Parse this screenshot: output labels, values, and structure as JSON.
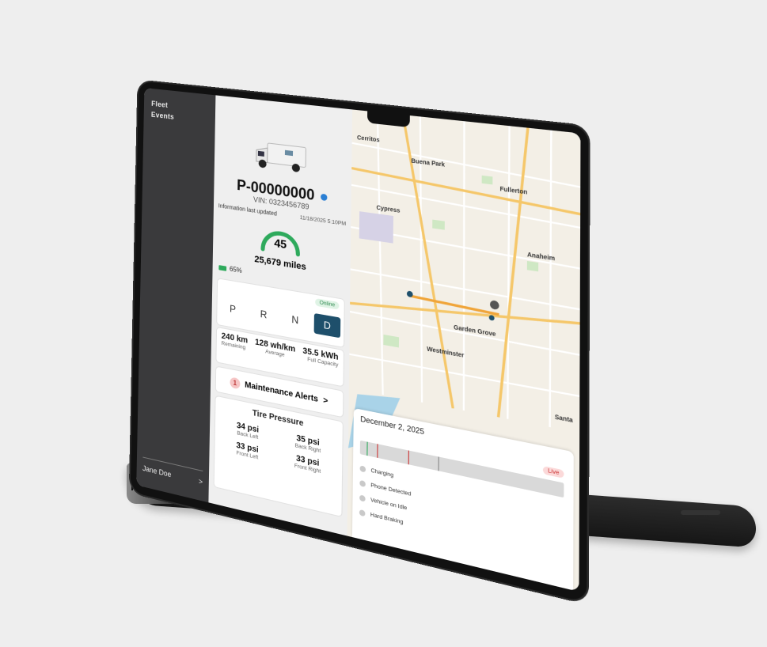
{
  "sidebar": {
    "nav": [
      "Fleet",
      "Events"
    ],
    "user_name": "Jane Doe",
    "user_chevron": ">"
  },
  "vehicle": {
    "id": "P-00000000",
    "vin": "VIN: 0323456789",
    "updated_label": "Information last updated",
    "updated_time": "11/18/2025 5:10PM",
    "speed": "45",
    "odometer": "25,679 miles",
    "battery": "65%",
    "status": "Online",
    "gears": [
      "P",
      "R",
      "N",
      "D"
    ],
    "active_gear": "D",
    "stats": [
      {
        "value": "240 km",
        "label": "Remaining"
      },
      {
        "value": "128 wh/km",
        "label": "Average"
      },
      {
        "value": "35.5 kWh",
        "label": "Full Capacity"
      }
    ],
    "alerts": {
      "count": "1",
      "label": "Maintenance Alerts",
      "chevron": ">"
    },
    "tires": {
      "title": "Tire Pressure",
      "items": [
        {
          "value": "34 psi",
          "label": "Back Left"
        },
        {
          "value": "35 psi",
          "label": "Back Right"
        },
        {
          "value": "33 psi",
          "label": "Front Left"
        },
        {
          "value": "33 psi",
          "label": "Front Right"
        }
      ]
    }
  },
  "map": {
    "cities": [
      "Cerritos",
      "Buena Park",
      "Fullerton",
      "Cypress",
      "Anaheim",
      "Garden Grove",
      "Westminster",
      "Santa"
    ]
  },
  "timeline": {
    "date": "December 2, 2025",
    "live": "Live",
    "events": [
      "Charging",
      "Phone Detected",
      "Vehicle on Idle",
      "Hard Braking"
    ]
  },
  "colors": {
    "accent": "#1e4f6b",
    "gauge": "#2eaa5c",
    "sidebar": "#3a3a3c",
    "alert": "#f6c6c6",
    "route": "#f0a53a"
  }
}
